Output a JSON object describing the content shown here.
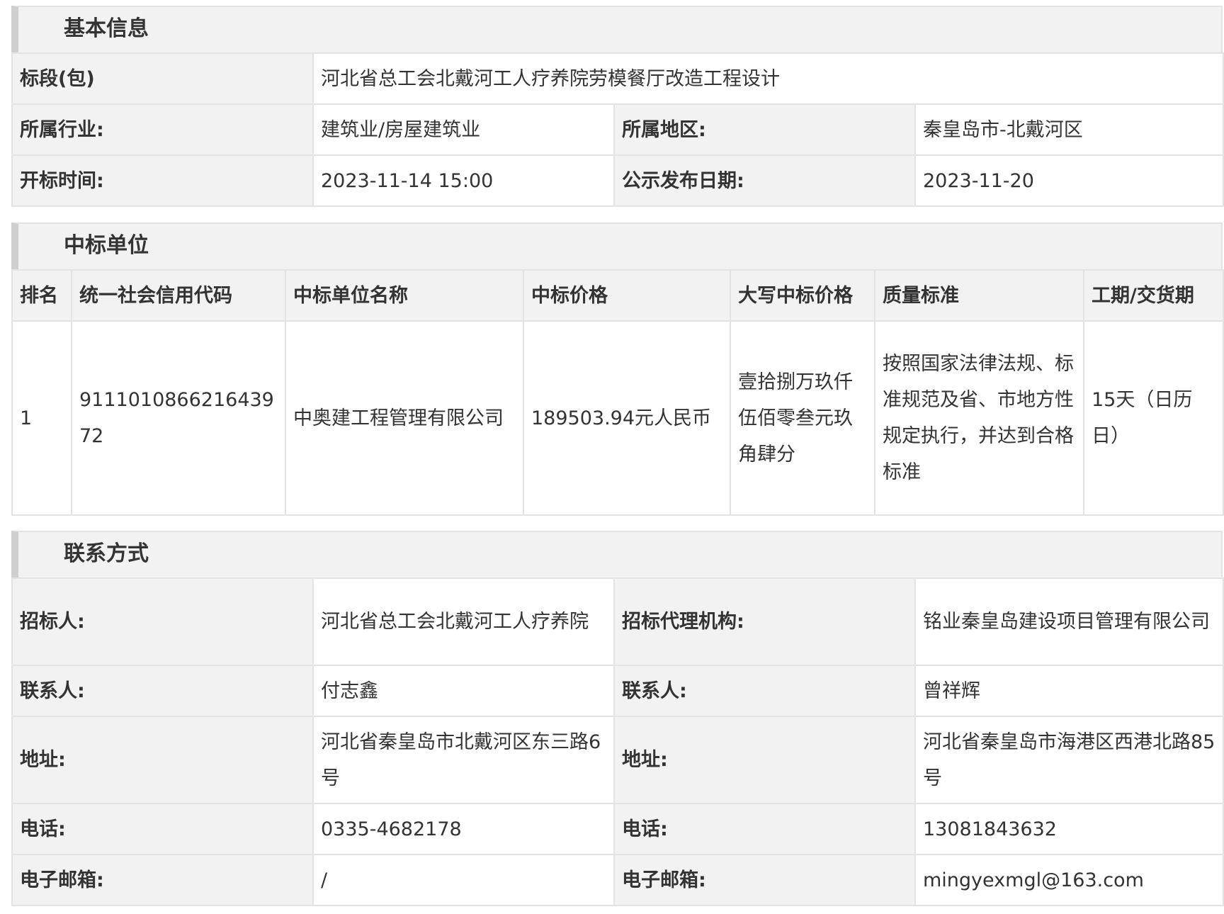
{
  "basic_info": {
    "title": "基本信息",
    "bid_section_label": "标段(包)",
    "bid_section_value": "河北省总工会北戴河工人疗养院劳模餐厅改造工程设计",
    "industry_label": "所属行业:",
    "industry_value": "建筑业/房屋建筑业",
    "region_label": "所属地区:",
    "region_value": "秦皇岛市-北戴河区",
    "open_time_label": "开标时间:",
    "open_time_value": "2023-11-14 15:00",
    "publish_date_label": "公示发布日期:",
    "publish_date_value": "2023-11-20"
  },
  "winner": {
    "title": "中标单位",
    "headers": [
      "排名",
      "统一社会信用代码",
      "中标单位名称",
      "中标价格",
      "大写中标价格",
      "质量标准",
      "工期/交货期"
    ],
    "rows": [
      [
        "1",
        "911101086621643972",
        "中奥建工程管理有限公司",
        "189503.94元人民币",
        "壹拾捌万玖仟伍佰零叁元玖角肆分",
        "按照国家法律法规、标准规范及省、市地方性规定执行，并达到合格标准",
        "15天（日历日）"
      ]
    ]
  },
  "contact": {
    "title": "联系方式",
    "tenderer_label": "招标人:",
    "tenderer_value": "河北省总工会北戴河工人疗养院",
    "agency_label": "招标代理机构:",
    "agency_value": "铭业秦皇岛建设项目管理有限公司",
    "contact_label_left": "联系人:",
    "contact_value_left": "付志鑫",
    "contact_label_right": "联系人:",
    "contact_value_right": "曾祥辉",
    "address_label_left": "地址:",
    "address_value_left": "河北省秦皇岛市北戴河区东三路6号",
    "address_label_right": "地址:",
    "address_value_right": "河北省秦皇岛市海港区西港北路85号",
    "phone_label_left": "电话:",
    "phone_value_left": "0335-4682178",
    "phone_label_right": "电话:",
    "phone_value_right": "13081843632",
    "email_label_left": "电子邮箱:",
    "email_value_left": "/",
    "email_label_right": "电子邮箱:",
    "email_value_right": "mingyexmgl@163.com"
  }
}
